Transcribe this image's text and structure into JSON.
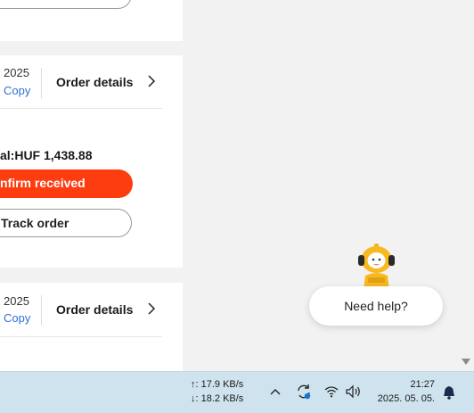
{
  "orders": [
    {
      "top_button_label": ""
    },
    {
      "year": "2025",
      "copy_label": "Copy",
      "details_label": "Order details",
      "total_text": "al:HUF 1,438.88",
      "status_label": "nfirm received",
      "track_label": "Track order"
    },
    {
      "year": "2025",
      "copy_label": "Copy",
      "details_label": "Order details"
    }
  ],
  "help": {
    "label": "Need help?"
  },
  "taskbar": {
    "upload": "↑: 17.9 KB/s",
    "download": "↓: 18.2 KB/s",
    "time": "21:27",
    "date": "2025. 05. 05.",
    "icons": [
      "chevron-up-icon",
      "sync-icon",
      "wifi-icon",
      "speaker-icon",
      "notification-bell-icon"
    ]
  },
  "colors": {
    "accent": "#fd3c10",
    "link": "#2f6fd6",
    "taskbar": "#cfe3ee"
  }
}
